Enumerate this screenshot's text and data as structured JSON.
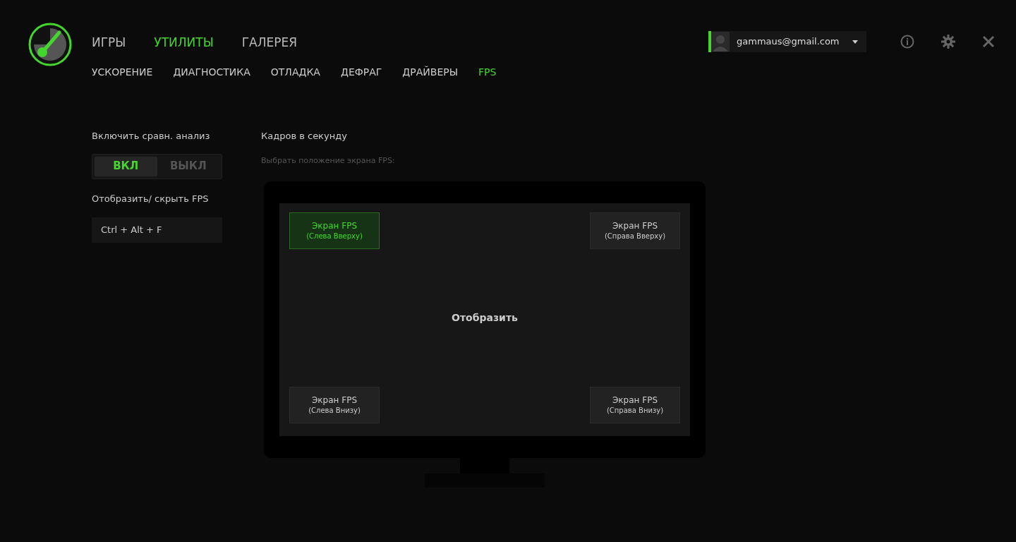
{
  "main_tabs": [
    {
      "label": "ИГРЫ",
      "selected": false
    },
    {
      "label": "УТИЛИТЫ",
      "selected": true
    },
    {
      "label": "ГАЛЕРЕЯ",
      "selected": false
    }
  ],
  "sub_tabs": [
    {
      "label": "УСКОРЕНИЕ",
      "selected": false
    },
    {
      "label": "ДИАГНОСТИКА",
      "selected": false
    },
    {
      "label": "ОТЛАДКА",
      "selected": false
    },
    {
      "label": "ДЕФРАГ",
      "selected": false
    },
    {
      "label": "ДРАЙВЕРЫ",
      "selected": false
    },
    {
      "label": "FPS",
      "selected": true
    }
  ],
  "account": {
    "email": "gammaus@gmail.com"
  },
  "benchmark": {
    "label": "Включить сравн. анализ",
    "options": [
      {
        "label": "ВКЛ",
        "selected": true
      },
      {
        "label": "ВЫКЛ",
        "selected": false
      }
    ]
  },
  "shortcut": {
    "label": "Отобразить/ скрыть FPS",
    "value": "Ctrl + Alt + F"
  },
  "fps_panel": {
    "title": "Кадров в секунду",
    "hint": "Выбрать положение экрана FPS:",
    "center_label": "Отобразить",
    "positions": [
      {
        "title": "Экран FPS",
        "subtitle": "(Слева Вверху)",
        "selected": true
      },
      {
        "title": "Экран FPS",
        "subtitle": "(Справа Вверху)",
        "selected": false
      },
      {
        "title": "Экран FPS",
        "subtitle": "(Слева Внизу)",
        "selected": false
      },
      {
        "title": "Экран FPS",
        "subtitle": "(Справа Внизу)",
        "selected": false
      }
    ]
  }
}
